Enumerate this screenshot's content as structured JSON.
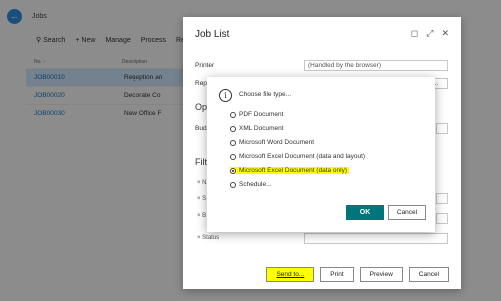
{
  "background_page": {
    "title": "Jobs",
    "actions": [
      {
        "icon": "search-icon",
        "label": "Search"
      },
      {
        "icon": "plus-icon",
        "label": "New"
      },
      {
        "icon": "",
        "label": "Manage"
      },
      {
        "icon": "",
        "label": "Process"
      },
      {
        "icon": "",
        "label": "Re"
      }
    ],
    "list_header": {
      "no": "No. ↑",
      "description": "Description"
    },
    "rows": [
      {
        "no": "JOB00010",
        "description": "Reception an",
        "selected": true
      },
      {
        "no": "JOB00020",
        "description": "Decorate Co",
        "selected": false
      },
      {
        "no": "JOB00030",
        "description": "New Office F",
        "selected": false
      }
    ]
  },
  "job_list_dialog": {
    "title": "Job List",
    "printer_label": "Printer",
    "printer_value": "(Handled by the browser)",
    "report_label": "Rep",
    "options_section": "Op",
    "budget_label": "Bud",
    "filter_section": "Filt",
    "filter_fields": [
      "× N",
      "× S",
      "× B",
      "× Status"
    ],
    "buttons": {
      "send_to": "Send to...",
      "print": "Print",
      "preview": "Preview",
      "cancel": "Cancel"
    }
  },
  "file_type_dialog": {
    "prompt": "Choose file type...",
    "options": [
      {
        "label": "PDF Document",
        "checked": false,
        "highlighted": false
      },
      {
        "label": "XML Document",
        "checked": false,
        "highlighted": false
      },
      {
        "label": "Microsoft Word Document",
        "checked": false,
        "highlighted": false
      },
      {
        "label": "Microsoft Excel Document (data and layout)",
        "checked": false,
        "highlighted": false
      },
      {
        "label": "Microsoft Excel Document (data only)",
        "checked": true,
        "highlighted": true
      },
      {
        "label": "Schedule...",
        "checked": false,
        "highlighted": false
      }
    ],
    "ok_label": "OK",
    "cancel_label": "Cancel"
  },
  "colors": {
    "accent": "#00757a",
    "highlight": "#ffff00",
    "link": "#1a6fb4",
    "selected_row": "#c7e0f4"
  }
}
